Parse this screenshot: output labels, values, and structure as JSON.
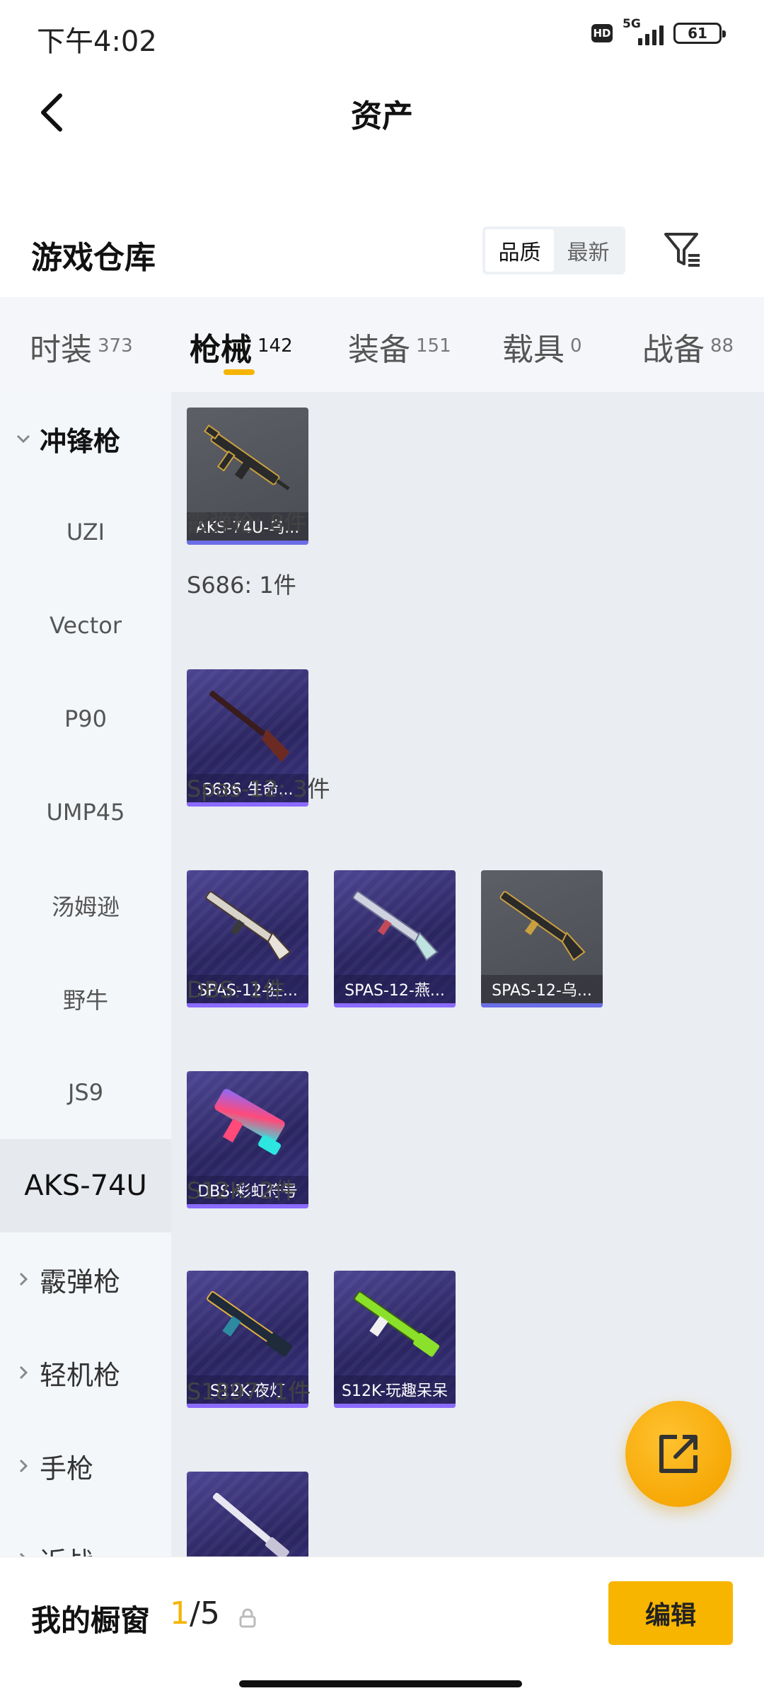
{
  "status_bar": {
    "time": "下午4:02",
    "hd": "HD",
    "network": "5G",
    "battery": "61"
  },
  "header": {
    "title": "资产",
    "back_icon": "chevron-left-icon"
  },
  "warehouse": {
    "title": "游戏仓库",
    "sort_options": [
      "品质",
      "最新"
    ],
    "sort_selected": "品质",
    "filter_icon": "filter-icon"
  },
  "tabs": [
    {
      "label": "时装",
      "count": "373"
    },
    {
      "label": "枪械",
      "count": "142",
      "active": true
    },
    {
      "label": "装备",
      "count": "151"
    },
    {
      "label": "载具",
      "count": "0"
    },
    {
      "label": "战备",
      "count": "88"
    }
  ],
  "sidebar": {
    "groups": [
      {
        "label": "冲锋枪",
        "expanded": true,
        "children": [
          "UZI",
          "Vector",
          "P90",
          "UMP45",
          "汤姆逊",
          "野牛",
          "JS9",
          "AKS-74U"
        ],
        "selected_child": "AKS-74U"
      },
      {
        "label": "霰弹枪",
        "expanded": false
      },
      {
        "label": "轻机枪",
        "expanded": false
      },
      {
        "label": "手枪",
        "expanded": false
      },
      {
        "label": "近战",
        "expanded": false
      }
    ]
  },
  "content": {
    "top_cards": [
      {
        "name": "AKS-74U-乌...",
        "style": "grey"
      }
    ],
    "category_title": "霰弹枪: 8件",
    "groups": [
      {
        "title": "S686: 1件",
        "cards": [
          {
            "name": "S686-生命...",
            "style": "purple"
          }
        ]
      },
      {
        "title": "Spas-12: 3件",
        "cards": [
          {
            "name": "SPAS-12-狂...",
            "style": "purple"
          },
          {
            "name": "SPAS-12-燕...",
            "style": "purple"
          },
          {
            "name": "SPAS-12-乌...",
            "style": "grey"
          }
        ]
      },
      {
        "title": "DBS: 1件",
        "cards": [
          {
            "name": "DBS-彩虹符号",
            "style": "purple"
          }
        ]
      },
      {
        "title": "S12K: 2件",
        "cards": [
          {
            "name": "S12K-夜灯",
            "style": "purple"
          },
          {
            "name": "S12K-玩趣呆呆",
            "style": "purple"
          }
        ]
      },
      {
        "title": "S1897: 1件",
        "cards": [
          {
            "name": "",
            "style": "purple"
          }
        ]
      }
    ]
  },
  "fab": {
    "icon": "share-external-icon"
  },
  "bottom_bar": {
    "label": "我的橱窗",
    "current": "1",
    "total": "/5",
    "lock_icon": "lock-icon",
    "edit_label": "编辑"
  },
  "colors": {
    "accent": "#f5b400",
    "card_purple": "#3c3585",
    "card_grey": "#55575e",
    "sidebar_bg": "#f4f7fa",
    "content_bg": "#eaedf1"
  }
}
